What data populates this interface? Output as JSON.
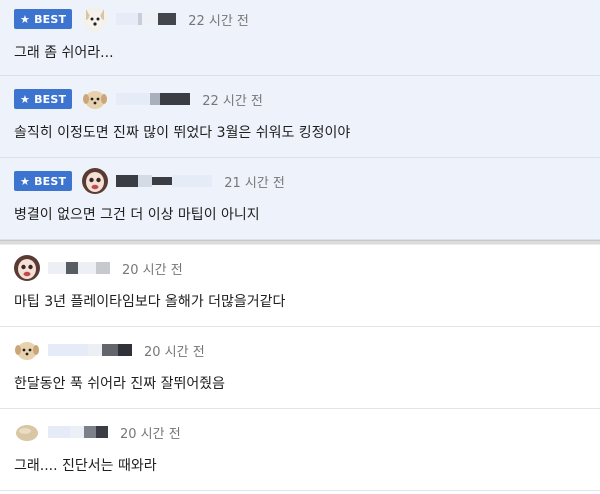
{
  "best_label": "BEST",
  "comments": [
    {
      "best": true,
      "avatar": "dog-face-avatar",
      "time": "22 시간 전",
      "text": "그래 좀 쉬어라..."
    },
    {
      "best": true,
      "avatar": "puppy-avatar",
      "time": "22 시간 전",
      "text": "솔직히 이정도면 진짜 많이 뛰었다 3월은 쉬워도 킹정이야"
    },
    {
      "best": true,
      "avatar": "face-avatar",
      "time": "21 시간 전",
      "text": "병결이 없으면 그건 더 이상 마팁이 아니지"
    },
    {
      "best": false,
      "avatar": "face-avatar",
      "time": "20 시간 전",
      "text": "마팁 3년 플레이타임보다 올해가 더많을거같다"
    },
    {
      "best": false,
      "avatar": "puppy-avatar",
      "time": "20 시간 전",
      "text": "한달동안 푹 쉬어라 진짜 잘뛰어줬음"
    },
    {
      "best": false,
      "avatar": "blob-avatar",
      "time": "20 시간 전",
      "text": "그래.... 진단서는 때와라"
    }
  ],
  "colors": {
    "accent": "#3c74cf",
    "best_bg": "#eef3fb"
  }
}
